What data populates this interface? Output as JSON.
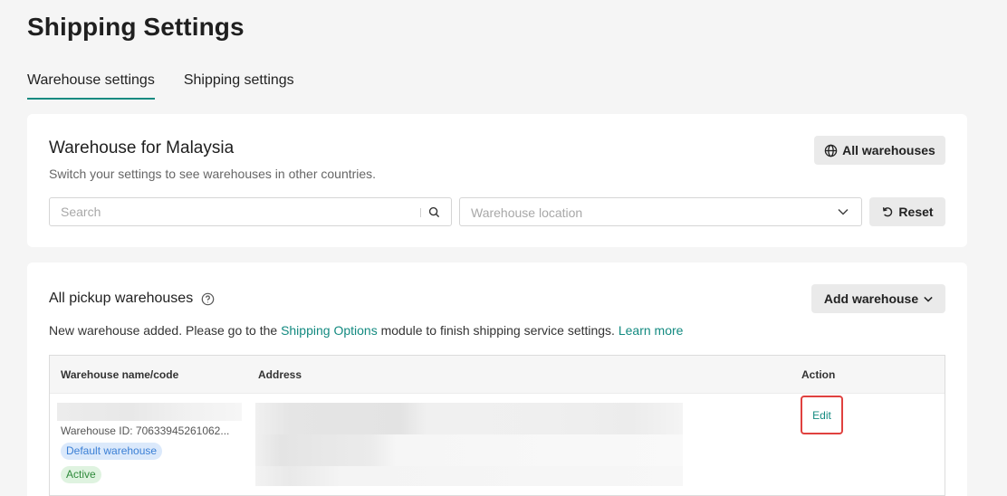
{
  "page": {
    "title": "Shipping Settings"
  },
  "tabs": [
    {
      "label": "Warehouse settings",
      "active": true
    },
    {
      "label": "Shipping settings",
      "active": false
    }
  ],
  "warehouse_filter": {
    "title": "Warehouse for Malaysia",
    "subtitle": "Switch your settings to see warehouses in other countries.",
    "all_warehouses_button": "All warehouses",
    "search_placeholder": "Search",
    "location_placeholder": "Warehouse location",
    "reset_button": "Reset"
  },
  "pickup": {
    "title": "All pickup warehouses",
    "add_button": "Add warehouse",
    "notice": {
      "before": "New warehouse added. Please go to the ",
      "link": "Shipping Options",
      "after": " module to finish shipping service settings. ",
      "learn_more": "Learn more"
    },
    "table": {
      "columns": [
        "Warehouse name/code",
        "Address",
        "Action"
      ],
      "rows": [
        {
          "warehouse_id": "Warehouse ID: 70633945261062...",
          "badges": [
            "Default warehouse",
            "Active"
          ],
          "action": "Edit"
        }
      ]
    }
  },
  "colors": {
    "accent": "#138a80",
    "highlight": "#e0413f",
    "default_badge": "#dbe9fb",
    "active_badge": "#dff3e0"
  },
  "icons": [
    "globe-icon",
    "search-icon",
    "chevron-down-icon",
    "reset-icon",
    "help-icon"
  ]
}
